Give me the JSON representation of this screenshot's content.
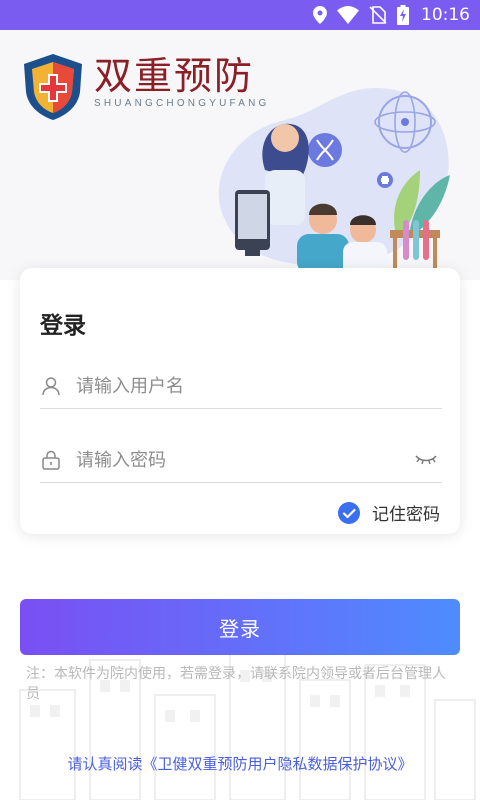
{
  "status_bar": {
    "time": "10:16",
    "icons": [
      "location-icon",
      "wifi-icon",
      "no-sim-icon",
      "battery-charging-icon"
    ]
  },
  "logo": {
    "title": "双重预防",
    "subtitle": "SHUANGCHONGYUFANG"
  },
  "login_card": {
    "title": "登录",
    "username_placeholder": "请输入用户名",
    "password_placeholder": "请输入密码",
    "remember_label": "记住密码",
    "remember_checked": true
  },
  "login_button_label": "登录",
  "note": "注：本软件为院内使用，若需登录，请联系院内领导或者后台管理人员",
  "agreement_link": "请认真阅读《卫健双重预防用户隐私数据保护协议》",
  "colors": {
    "status_bar": "#7a5cf0",
    "button_start": "#7a4ff3",
    "button_end": "#4e8cff",
    "link": "#4a5fe0",
    "check": "#3a6ff0"
  }
}
